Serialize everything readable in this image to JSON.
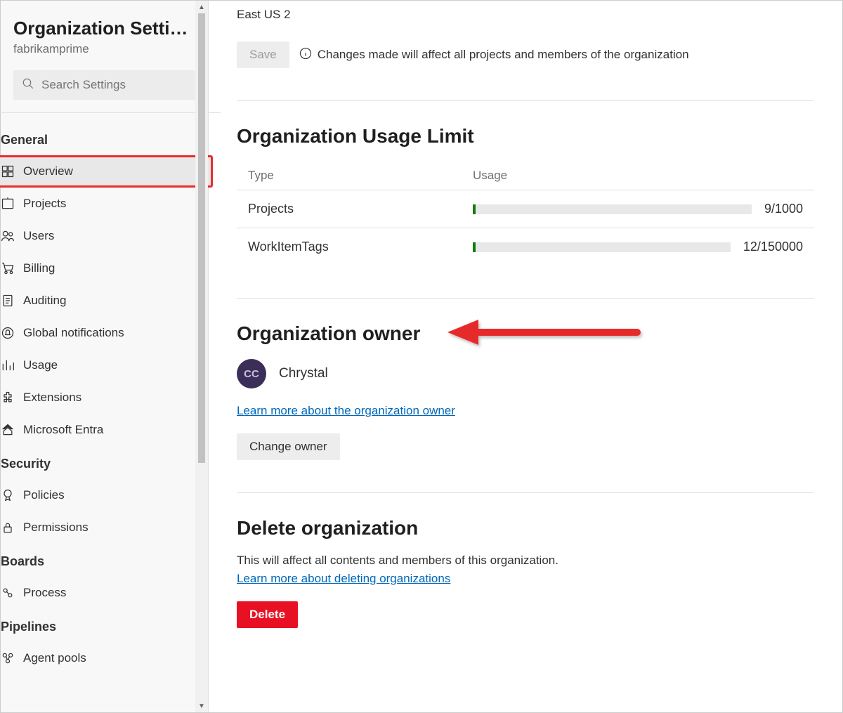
{
  "sidebar": {
    "title": "Organization Settin...",
    "subtitle": "fabrikamprime",
    "search_placeholder": "Search Settings",
    "sections": [
      {
        "title": "General",
        "items": [
          {
            "label": "Overview",
            "icon": "overview",
            "active": true,
            "highlight": true
          },
          {
            "label": "Projects",
            "icon": "projects"
          },
          {
            "label": "Users",
            "icon": "users"
          },
          {
            "label": "Billing",
            "icon": "billing"
          },
          {
            "label": "Auditing",
            "icon": "auditing"
          },
          {
            "label": "Global notifications",
            "icon": "notifications"
          },
          {
            "label": "Usage",
            "icon": "usage"
          },
          {
            "label": "Extensions",
            "icon": "extensions"
          },
          {
            "label": "Microsoft Entra",
            "icon": "entra"
          }
        ]
      },
      {
        "title": "Security",
        "items": [
          {
            "label": "Policies",
            "icon": "policies"
          },
          {
            "label": "Permissions",
            "icon": "permissions"
          }
        ]
      },
      {
        "title": "Boards",
        "items": [
          {
            "label": "Process",
            "icon": "process"
          }
        ]
      },
      {
        "title": "Pipelines",
        "items": [
          {
            "label": "Agent pools",
            "icon": "agentpools"
          }
        ]
      }
    ]
  },
  "main": {
    "region": "East US 2",
    "save_label": "Save",
    "save_warning": "Changes made will affect all projects and members of the organization",
    "usage": {
      "heading": "Organization Usage Limit",
      "col_type": "Type",
      "col_usage": "Usage",
      "rows": [
        {
          "type": "Projects",
          "used": 9,
          "limit": 1000,
          "display": "9/1000"
        },
        {
          "type": "WorkItemTags",
          "used": 12,
          "limit": 150000,
          "display": "12/150000"
        }
      ]
    },
    "owner": {
      "heading": "Organization owner",
      "avatar_initials": "CC",
      "name": "Chrystal",
      "learn_more": "Learn more about the organization owner",
      "change_label": "Change owner"
    },
    "delete": {
      "heading": "Delete organization",
      "description": "This will affect all contents and members of this organization.",
      "learn_more": "Learn more about deleting organizations",
      "button": "Delete"
    }
  }
}
